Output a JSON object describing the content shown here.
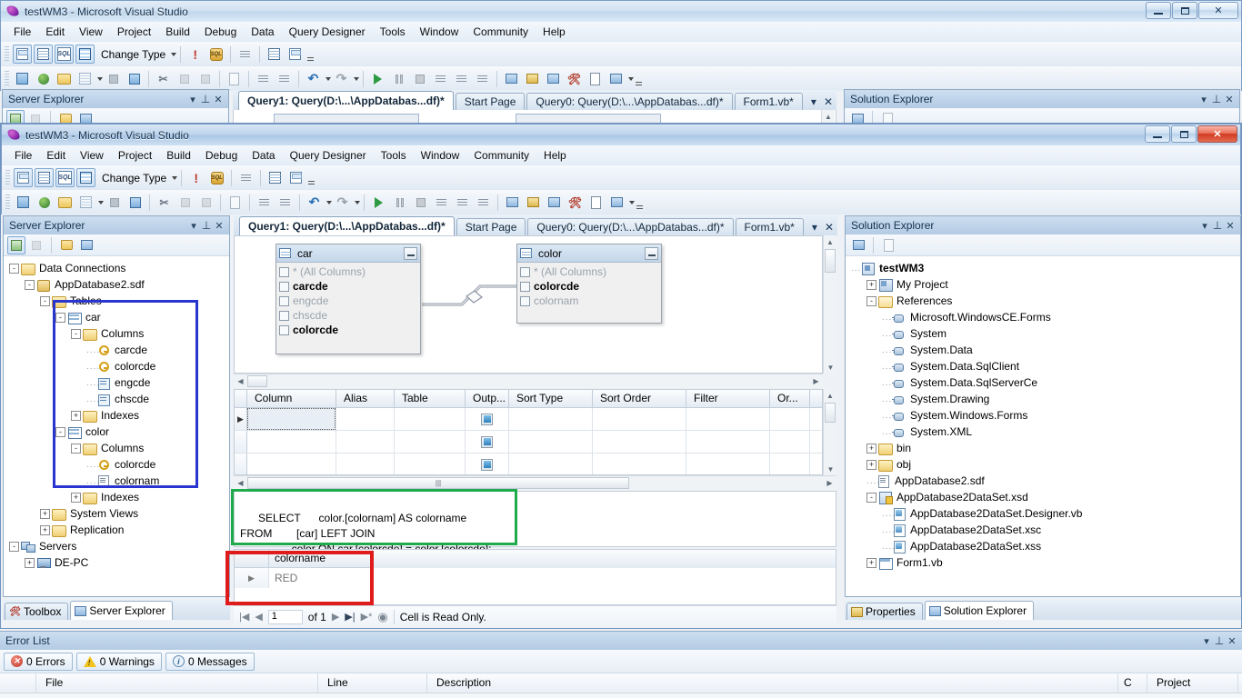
{
  "window_back": {
    "title": "testWM3 - Microsoft Visual Studio",
    "buttons": {
      "minimize": "minimize-icon",
      "maximize": "maximize-icon",
      "close": "close-icon"
    }
  },
  "window_front": {
    "title": "testWM3 - Microsoft Visual Studio",
    "buttons": {
      "minimize": "minimize-icon",
      "maximize": "maximize-icon",
      "close": "close-icon"
    }
  },
  "menu": [
    "File",
    "Edit",
    "View",
    "Project",
    "Build",
    "Debug",
    "Data",
    "Query Designer",
    "Tools",
    "Window",
    "Community",
    "Help"
  ],
  "query_toolbar": {
    "buttons": [
      "show-diagram-pane-button",
      "show-criteria-pane-button",
      "show-sql-pane-button",
      "show-results-pane-button"
    ],
    "change_type_label": "Change Type",
    "extra": [
      "verify-sql-syntax-button",
      "execute-sql-button",
      "group-by-button",
      "add-table-button",
      "add-new-derived-table-button"
    ]
  },
  "standard_toolbar": {
    "buttons": [
      "new-project-icon",
      "add-new-item-icon",
      "open-file-icon",
      "new-grid-icon",
      "save-icon",
      "save-all-icon",
      "cut-icon",
      "copy-icon",
      "paste-icon",
      "find-icon",
      "comment-icon",
      "uncomment-icon",
      "undo-icon",
      "redo-icon",
      "start-debug-icon",
      "pause-icon",
      "stop-icon",
      "step-into-icon",
      "step-over-icon",
      "step-out-icon",
      "solution-explorer-icon",
      "properties-window-icon",
      "object-browser-icon",
      "toolbox-icon",
      "error-list-icon",
      "command-window-icon"
    ]
  },
  "server_explorer": {
    "title": "Server Explorer",
    "toolbar": [
      "refresh-icon",
      "stop-icon",
      "connect-to-database-icon",
      "connect-to-server-icon"
    ],
    "tree": [
      {
        "label": "Data Connections",
        "depth": 0,
        "expander": "-",
        "icon": "folder-icon"
      },
      {
        "label": "AppDatabase2.sdf",
        "depth": 1,
        "expander": "-",
        "icon": "connection-icon"
      },
      {
        "label": "Tables",
        "depth": 2,
        "expander": "-",
        "icon": "folder-icon"
      },
      {
        "label": "car",
        "depth": 3,
        "expander": "-",
        "icon": "table-icon"
      },
      {
        "label": "Columns",
        "depth": 4,
        "expander": "-",
        "icon": "folder-icon"
      },
      {
        "label": "carcde",
        "depth": 5,
        "expander": "",
        "icon": "primary-key-icon"
      },
      {
        "label": "colorcde",
        "depth": 5,
        "expander": "",
        "icon": "primary-key-icon"
      },
      {
        "label": "engcde",
        "depth": 5,
        "expander": "",
        "icon": "column-icon"
      },
      {
        "label": "chscde",
        "depth": 5,
        "expander": "",
        "icon": "column-icon"
      },
      {
        "label": "Indexes",
        "depth": 4,
        "expander": "+",
        "icon": "folder-icon"
      },
      {
        "label": "color",
        "depth": 3,
        "expander": "-",
        "icon": "table-icon"
      },
      {
        "label": "Columns",
        "depth": 4,
        "expander": "-",
        "icon": "folder-icon"
      },
      {
        "label": "colorcde",
        "depth": 5,
        "expander": "",
        "icon": "primary-key-icon"
      },
      {
        "label": "colornam",
        "depth": 5,
        "expander": "",
        "icon": "text-column-icon"
      },
      {
        "label": "Indexes",
        "depth": 4,
        "expander": "+",
        "icon": "folder-icon"
      },
      {
        "label": "System Views",
        "depth": 2,
        "expander": "+",
        "icon": "folder-icon"
      },
      {
        "label": "Replication",
        "depth": 2,
        "expander": "+",
        "icon": "folder-icon"
      },
      {
        "label": "Servers",
        "depth": 0,
        "expander": "-",
        "icon": "servers-icon"
      },
      {
        "label": "DE-PC",
        "depth": 1,
        "expander": "+",
        "icon": "computer-icon"
      }
    ],
    "bottom_tabs": [
      {
        "label": "Toolbox",
        "icon": "toolbox-icon",
        "active": false
      },
      {
        "label": "Server Explorer",
        "icon": "server-explorer-icon",
        "active": true
      }
    ]
  },
  "document_tabs": [
    {
      "label": "Query1: Query(D:\\...\\AppDatabas...df)*",
      "active": true
    },
    {
      "label": "Start Page",
      "active": false
    },
    {
      "label": "Query0: Query(D:\\...\\AppDatabas...df)*",
      "active": false
    },
    {
      "label": "Form1.vb*",
      "active": false
    }
  ],
  "diagram": {
    "tables": [
      {
        "name": "car",
        "columns": [
          {
            "label": "* (All Columns)",
            "checked": false,
            "style": "gray"
          },
          {
            "label": "carcde",
            "checked": false,
            "style": "bold"
          },
          {
            "label": "engcde",
            "checked": false,
            "style": "gray"
          },
          {
            "label": "chscde",
            "checked": false,
            "style": "gray"
          },
          {
            "label": "colorcde",
            "checked": false,
            "style": "bold"
          }
        ]
      },
      {
        "name": "color",
        "columns": [
          {
            "label": "* (All Columns)",
            "checked": false,
            "style": "gray"
          },
          {
            "label": "colorcde",
            "checked": false,
            "style": "bold"
          },
          {
            "label": "colornam",
            "checked": false,
            "style": "gray"
          }
        ]
      }
    ],
    "join": "left-join-link"
  },
  "criteria_grid": {
    "columns": [
      "Column",
      "Alias",
      "Table",
      "Outp...",
      "Sort Type",
      "Sort Order",
      "Filter",
      "Or..."
    ],
    "rows": [
      {
        "column": "",
        "alias": "",
        "table": "",
        "output": true,
        "sort_type": "",
        "sort_order": "",
        "filter": "",
        "or": "",
        "selected": true
      },
      {
        "column": "",
        "alias": "",
        "table": "",
        "output": true,
        "sort_type": "",
        "sort_order": "",
        "filter": "",
        "or": ""
      },
      {
        "column": "",
        "alias": "",
        "table": "",
        "output": true,
        "sort_type": "",
        "sort_order": "",
        "filter": "",
        "or": ""
      }
    ]
  },
  "sql_pane": {
    "text": "SELECT      color.[colornam] AS colorname\nFROM        [car] LEFT JOIN\n                 color ON car.[colorcde] = color.[colorcde];"
  },
  "results": {
    "columns": [
      "colorname"
    ],
    "rows": [
      [
        "RED"
      ]
    ],
    "row_marker": "current-row-arrow"
  },
  "results_status": {
    "page_value": "1",
    "of_label": "of 1",
    "message": "Cell is Read Only.",
    "nav": [
      "first-record-button",
      "previous-record-button",
      "next-record-button",
      "last-record-button",
      "new-record-button",
      "stop-button"
    ]
  },
  "solution_explorer": {
    "title": "Solution Explorer",
    "toolbar": [
      "properties-icon",
      "show-all-files-icon"
    ],
    "tree": [
      {
        "label": "testWM3",
        "depth": 0,
        "expander": "",
        "icon": "project-icon",
        "bold": true
      },
      {
        "label": "My Project",
        "depth": 1,
        "expander": "+",
        "icon": "my-project-icon"
      },
      {
        "label": "References",
        "depth": 1,
        "expander": "-",
        "icon": "references-folder-icon"
      },
      {
        "label": "Microsoft.WindowsCE.Forms",
        "depth": 2,
        "expander": "",
        "icon": "reference-icon"
      },
      {
        "label": "System",
        "depth": 2,
        "expander": "",
        "icon": "reference-icon"
      },
      {
        "label": "System.Data",
        "depth": 2,
        "expander": "",
        "icon": "reference-icon"
      },
      {
        "label": "System.Data.SqlClient",
        "depth": 2,
        "expander": "",
        "icon": "reference-icon"
      },
      {
        "label": "System.Data.SqlServerCe",
        "depth": 2,
        "expander": "",
        "icon": "reference-icon"
      },
      {
        "label": "System.Drawing",
        "depth": 2,
        "expander": "",
        "icon": "reference-icon"
      },
      {
        "label": "System.Windows.Forms",
        "depth": 2,
        "expander": "",
        "icon": "reference-icon"
      },
      {
        "label": "System.XML",
        "depth": 2,
        "expander": "",
        "icon": "reference-icon"
      },
      {
        "label": "bin",
        "depth": 1,
        "expander": "+",
        "icon": "folder-icon"
      },
      {
        "label": "obj",
        "depth": 1,
        "expander": "+",
        "icon": "folder-icon"
      },
      {
        "label": "AppDatabase2.sdf",
        "depth": 1,
        "expander": "",
        "icon": "database-file-icon"
      },
      {
        "label": "AppDatabase2DataSet.xsd",
        "depth": 1,
        "expander": "-",
        "icon": "dataset-icon"
      },
      {
        "label": "AppDatabase2DataSet.Designer.vb",
        "depth": 2,
        "expander": "",
        "icon": "vb-file-icon"
      },
      {
        "label": "AppDatabase2DataSet.xsc",
        "depth": 2,
        "expander": "",
        "icon": "vb-file-icon"
      },
      {
        "label": "AppDatabase2DataSet.xss",
        "depth": 2,
        "expander": "",
        "icon": "vb-file-icon"
      },
      {
        "label": "Form1.vb",
        "depth": 1,
        "expander": "+",
        "icon": "form-icon"
      }
    ],
    "bottom_tabs": [
      {
        "label": "Properties",
        "icon": "properties-icon",
        "active": false
      },
      {
        "label": "Solution Explorer",
        "icon": "solution-explorer-icon",
        "active": true
      }
    ]
  },
  "error_list": {
    "title": "Error List",
    "filters": [
      {
        "label": "0 Errors",
        "icon": "error-icon"
      },
      {
        "label": "0 Warnings",
        "icon": "warning-icon"
      },
      {
        "label": "0 Messages",
        "icon": "info-icon"
      }
    ],
    "columns": [
      "",
      "File",
      "Line",
      "Description",
      "C",
      "Project"
    ]
  },
  "highlights": {
    "tree_box_color": "#2a35cf",
    "sql_box_color": "#1faa4b",
    "results_box_color": "#e01b1b"
  }
}
